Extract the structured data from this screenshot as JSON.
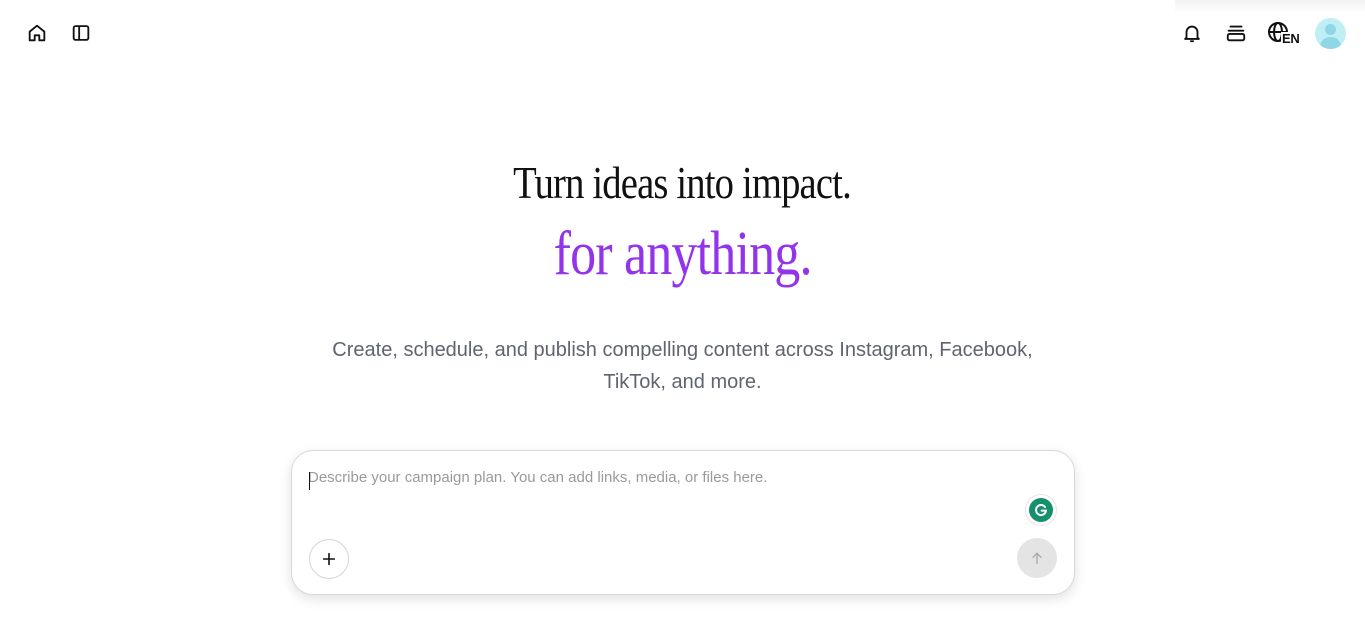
{
  "header": {
    "left_icons": [
      "home-icon",
      "sidebar-toggle-icon"
    ],
    "right_icons": [
      "bell-icon",
      "stack-icon",
      "globe-icon"
    ],
    "language_code": "EN"
  },
  "hero": {
    "title": "Turn ideas into impact.",
    "tagline": "for anything.",
    "subtitle": "Create, schedule, and publish compelling content across Instagram, Facebook, TikTok, and more."
  },
  "composer": {
    "placeholder": "Describe your campaign plan. You can add links, media, or files here.",
    "value": "",
    "add_icon": "plus-icon",
    "send_icon": "arrow-up-icon",
    "extension_icon": "grammarly-icon"
  },
  "colors": {
    "accent": "#9333ea",
    "subtitle": "#5f6470",
    "avatar_bg": "#bfeef5",
    "grammarly": "#15906f"
  }
}
